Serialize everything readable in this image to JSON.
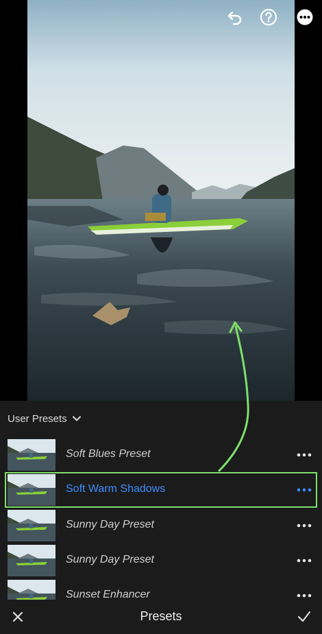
{
  "toolbar": {
    "undo_icon": "undo-icon",
    "help_icon": "help-icon",
    "more_icon": "more-icon"
  },
  "presets_panel": {
    "group_label": "User Presets",
    "items": [
      {
        "label": "Soft Blues Preset",
        "selected": false
      },
      {
        "label": "Soft Warm Shadows",
        "selected": true
      },
      {
        "label": "Sunny Day Preset",
        "selected": false
      },
      {
        "label": "Sunny Day Preset",
        "selected": false
      },
      {
        "label": "Sunset Enhancer",
        "selected": false
      }
    ],
    "selected_color": "#3d8bff",
    "highlight_color": "#7de06a"
  },
  "bottom_bar": {
    "title": "Presets",
    "cancel_icon": "close-icon",
    "confirm_icon": "check-icon"
  }
}
